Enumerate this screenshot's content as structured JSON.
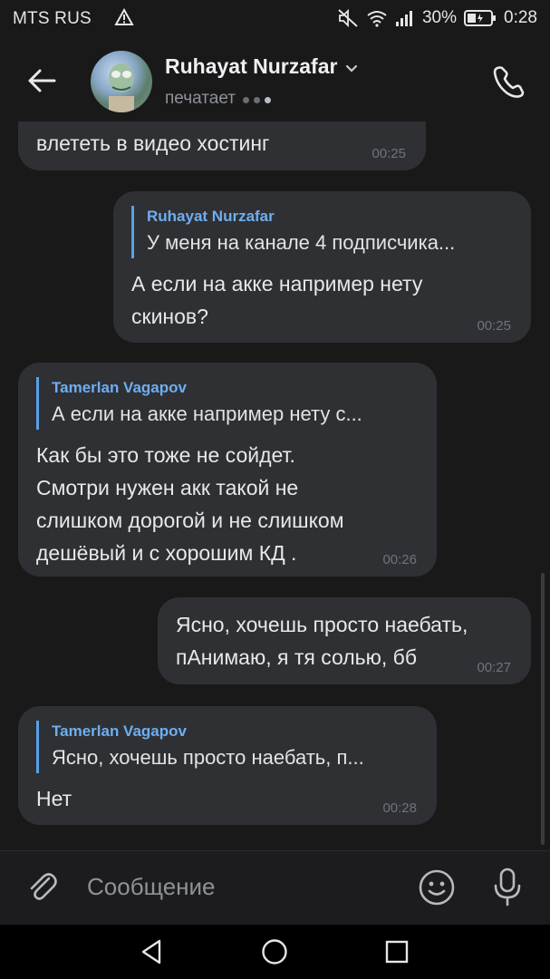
{
  "status_bar": {
    "carrier": "MTS RUS",
    "battery": "30%",
    "time": "0:28"
  },
  "header": {
    "title": "Ruhayat Nurzafar",
    "subtitle": "печатает"
  },
  "messages": [
    {
      "direction": "incoming",
      "text": "влететь в видео хостинг",
      "time": "00:25"
    },
    {
      "direction": "outgoing",
      "reply_name": "Ruhayat Nurzafar",
      "reply_text": "У меня на канале 4 подписчика...",
      "lines": [
        "А если на акке например нету",
        "скинов?"
      ],
      "time": "00:25"
    },
    {
      "direction": "incoming",
      "reply_name": "Tamerlan Vagapov",
      "reply_text": "А если на акке например нету с...",
      "lines": [
        "Как бы это тоже не сойдет.",
        "Смотри нужен акк такой не",
        "слишком дорогой и не слишком",
        "дешёвый и с хорошим КД ."
      ],
      "time": "00:26"
    },
    {
      "direction": "outgoing",
      "lines": [
        "Ясно, хочешь просто наебать,",
        "пАнимаю, я тя солью, бб"
      ],
      "time": "00:27"
    },
    {
      "direction": "incoming",
      "reply_name": "Tamerlan Vagapov",
      "reply_text": "Ясно, хочешь просто наебать, п...",
      "lines": [
        "Нет"
      ],
      "time": "00:28"
    }
  ],
  "composer": {
    "placeholder": "Сообщение"
  },
  "icons": {
    "back": "arrow-left-icon",
    "call": "phone-icon",
    "attach": "paperclip-icon",
    "emoji": "smile-icon",
    "mic": "microphone-icon"
  },
  "colors": {
    "background": "#19191a",
    "bubble": "#2f3034",
    "accent": "#5aa0e8"
  }
}
